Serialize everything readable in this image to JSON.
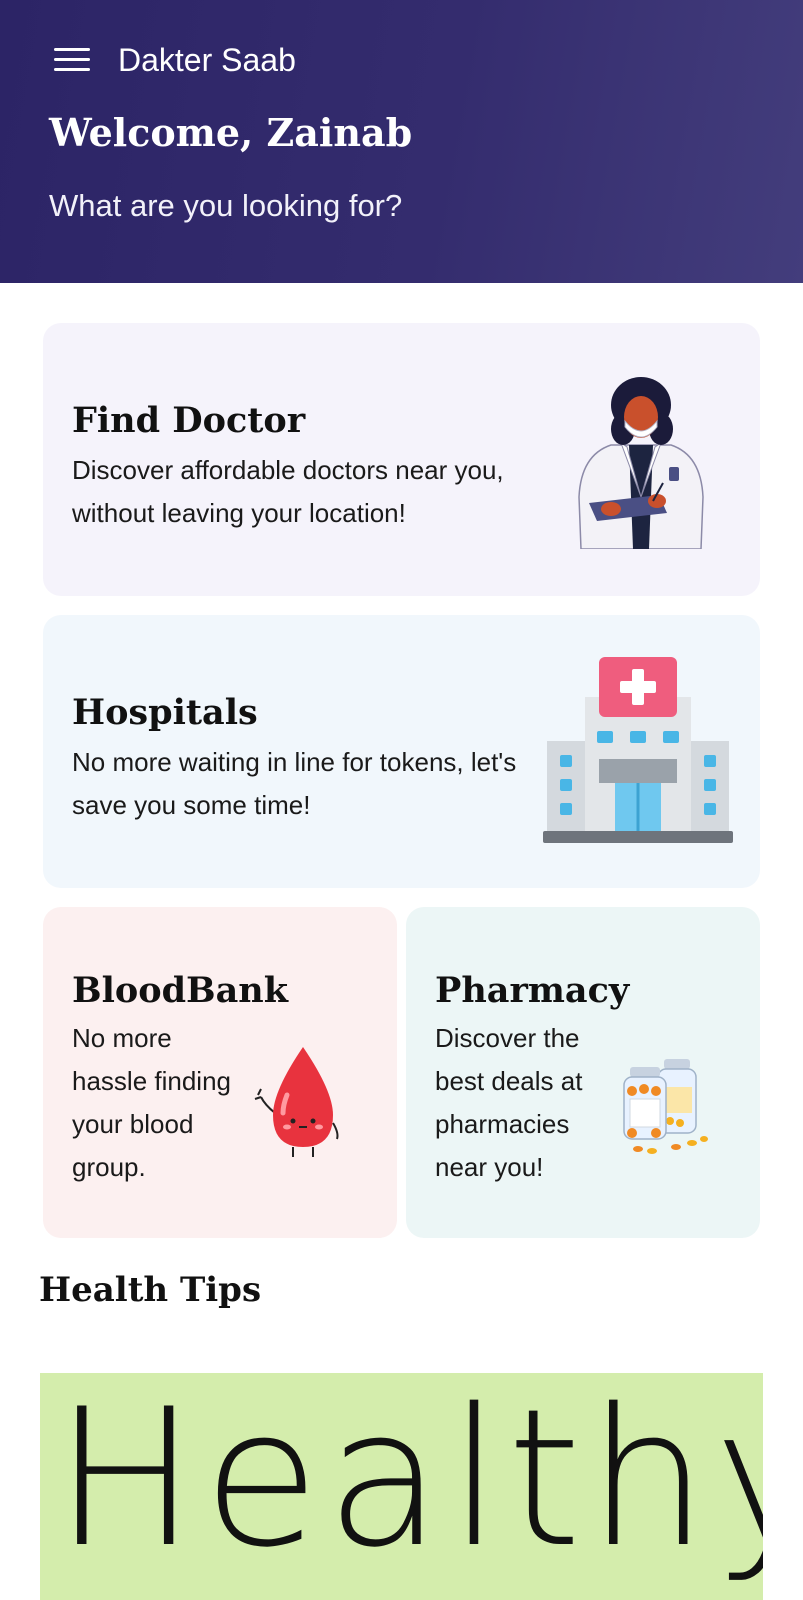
{
  "header": {
    "app_name": "Dakter Saab",
    "welcome": "Welcome, Zainab",
    "subtitle": "What are you looking for?"
  },
  "cards": {
    "doctor": {
      "title": "Find Doctor",
      "desc_line1": "Discover affordable doctors near you,",
      "desc_line2": "without leaving your location!",
      "icon": "doctor-illustration",
      "bg": "#f5f3fb"
    },
    "hospitals": {
      "title": "Hospitals",
      "desc_line1": "No more waiting in line for tokens, let's",
      "desc_line2": "save you some time!",
      "icon": "hospital-building-illustration",
      "bg": "#f1f7fc"
    },
    "bloodbank": {
      "title": "BloodBank",
      "desc_lines": [
        "No more",
        "hassle finding",
        "your blood",
        "group."
      ],
      "icon": "blood-drop-illustration",
      "bg": "#fcf0f0"
    },
    "pharmacy": {
      "title": "Pharmacy",
      "desc_lines": [
        "Discover the",
        "best deals at",
        "pharmacies",
        "near you!"
      ],
      "icon": "pill-bottles-illustration",
      "bg": "#ecf6f6"
    }
  },
  "health_tips": {
    "heading": "Health Tips",
    "banner_text": "Healthy",
    "banner_bg": "#d4edac"
  },
  "colors": {
    "header_gradient_start": "#2c2466",
    "header_gradient_end": "#433d7c"
  }
}
